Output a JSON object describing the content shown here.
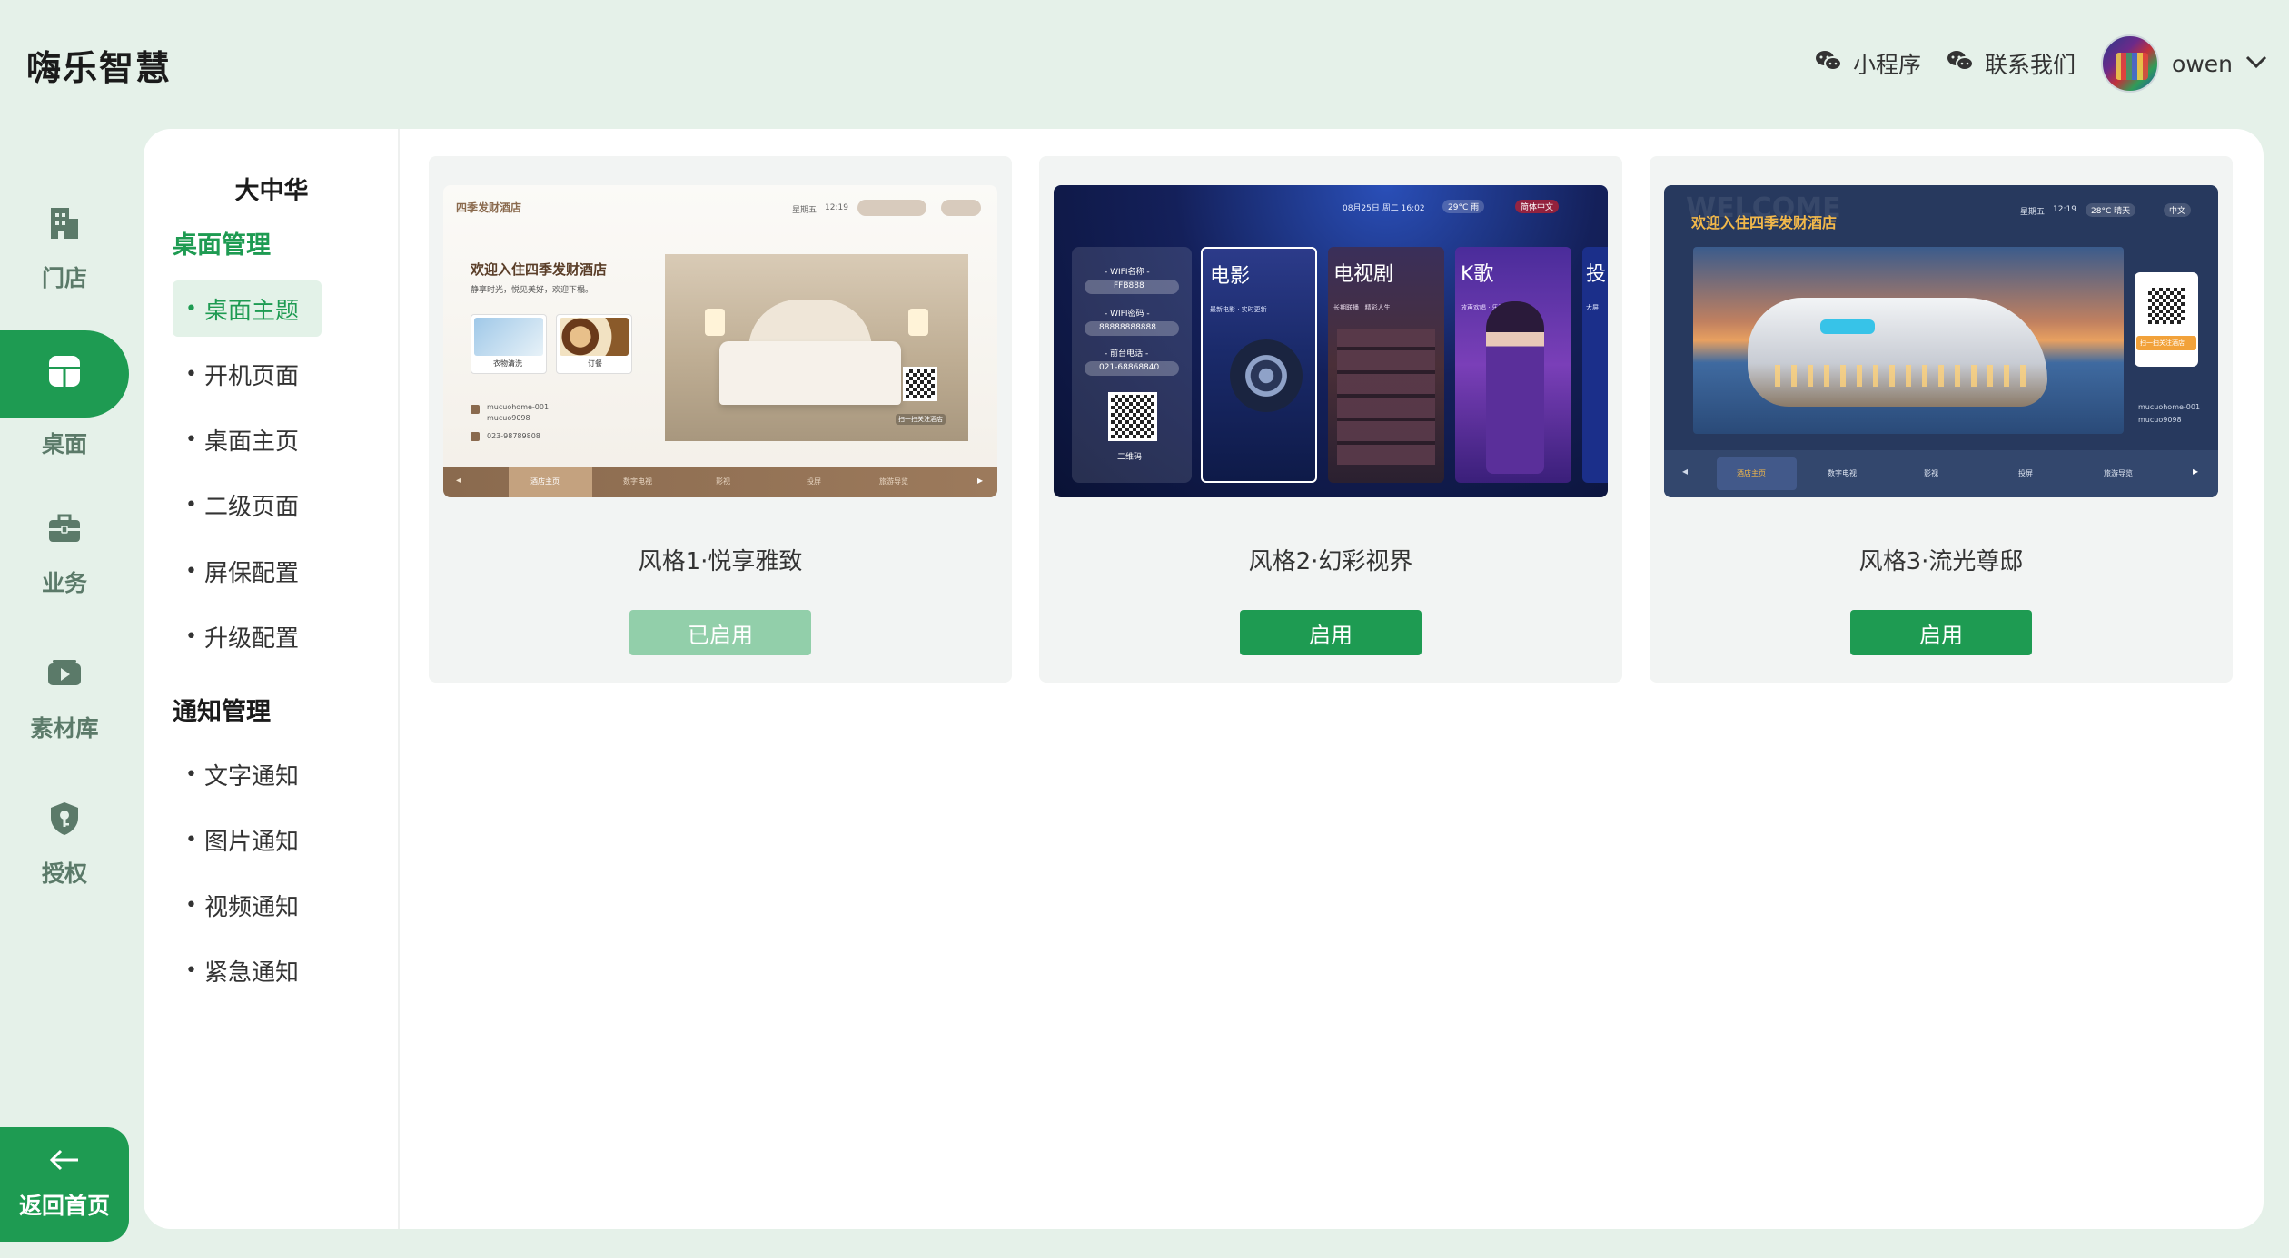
{
  "app": {
    "title": "嗨乐智慧"
  },
  "header": {
    "mini_program": "小程序",
    "contact_us": "联系我们",
    "user_name": "owen"
  },
  "nav": {
    "items": [
      {
        "label": "门店",
        "icon": "store-icon"
      },
      {
        "label": "桌面",
        "icon": "desktop-icon",
        "active": true
      },
      {
        "label": "业务",
        "icon": "briefcase-icon"
      },
      {
        "label": "素材库",
        "icon": "media-library-icon"
      },
      {
        "label": "授权",
        "icon": "shield-key-icon"
      }
    ],
    "back_home": "返回首页"
  },
  "submenu": {
    "store_name": "大中华",
    "groups": [
      {
        "title": "桌面管理",
        "items": [
          "桌面主题",
          "开机页面",
          "桌面主页",
          "二级页面",
          "屏保配置",
          "升级配置"
        ],
        "active": "桌面主题"
      },
      {
        "title": "通知管理",
        "items": [
          "文字通知",
          "图片通知",
          "视频通知",
          "紧急通知"
        ]
      }
    ]
  },
  "themes": [
    {
      "name": "风格1·悦享雅致",
      "button": "已启用",
      "enabled": true,
      "preview": {
        "logo": "四季发财酒店",
        "weekday": "星期五",
        "time": "12:19",
        "welcome": "欢迎入住四季发财酒店",
        "tagline": "静享时光，悦见美好，欢迎下榻。",
        "card1": "衣物清洗",
        "card2": "订餐",
        "wifi_name": "mucuohome-001",
        "wifi_pwd": "mucuo9098",
        "phone": "023-98789808",
        "qr_caption": "扫一扫关注酒店",
        "tabs": [
          "酒店主页",
          "数字电视",
          "影视",
          "投屏",
          "旅游导览"
        ]
      }
    },
    {
      "name": "风格2·幻彩视界",
      "button": "启用",
      "enabled": false,
      "preview": {
        "date": "08月25日 周二 16:02",
        "weather": "29°C 雨",
        "lang": "简体中文",
        "wifi_name_label": "- WIFI名称 -",
        "wifi_name": "FFB888",
        "wifi_pwd_label": "- WIFI密码 -",
        "wifi_pwd": "88888888888",
        "phone_label": "- 前台电话 -",
        "phone": "021-68868840",
        "qr_label": "二维码",
        "tiles": [
          {
            "title": "电影",
            "sub": "最新电影 · 实时更新"
          },
          {
            "title": "电视剧",
            "sub": "长期联播 · 精彩人生"
          },
          {
            "title": "K歌",
            "sub": "放声欢唱 · 乐享生活"
          },
          {
            "title": "投",
            "sub": "大屏"
          }
        ]
      }
    },
    {
      "name": "风格3·流光尊邸",
      "button": "启用",
      "enabled": false,
      "preview": {
        "watermark": "WELCOME",
        "welcome": "欢迎入住四季发财酒店",
        "weekday": "星期五",
        "time": "12:19",
        "weather": "28°C 晴天",
        "lang": "中文",
        "qr_caption": "扫一扫关注酒店",
        "wifi_name": "mucuohome-001",
        "wifi_pwd": "mucuo9098",
        "tabs": [
          "酒店主页",
          "数字电视",
          "影视",
          "投屏",
          "旅游导览"
        ]
      }
    }
  ],
  "colors": {
    "accent": "#1e9b52",
    "accent_light": "#92cfaa",
    "bg": "#e5f1e9"
  }
}
